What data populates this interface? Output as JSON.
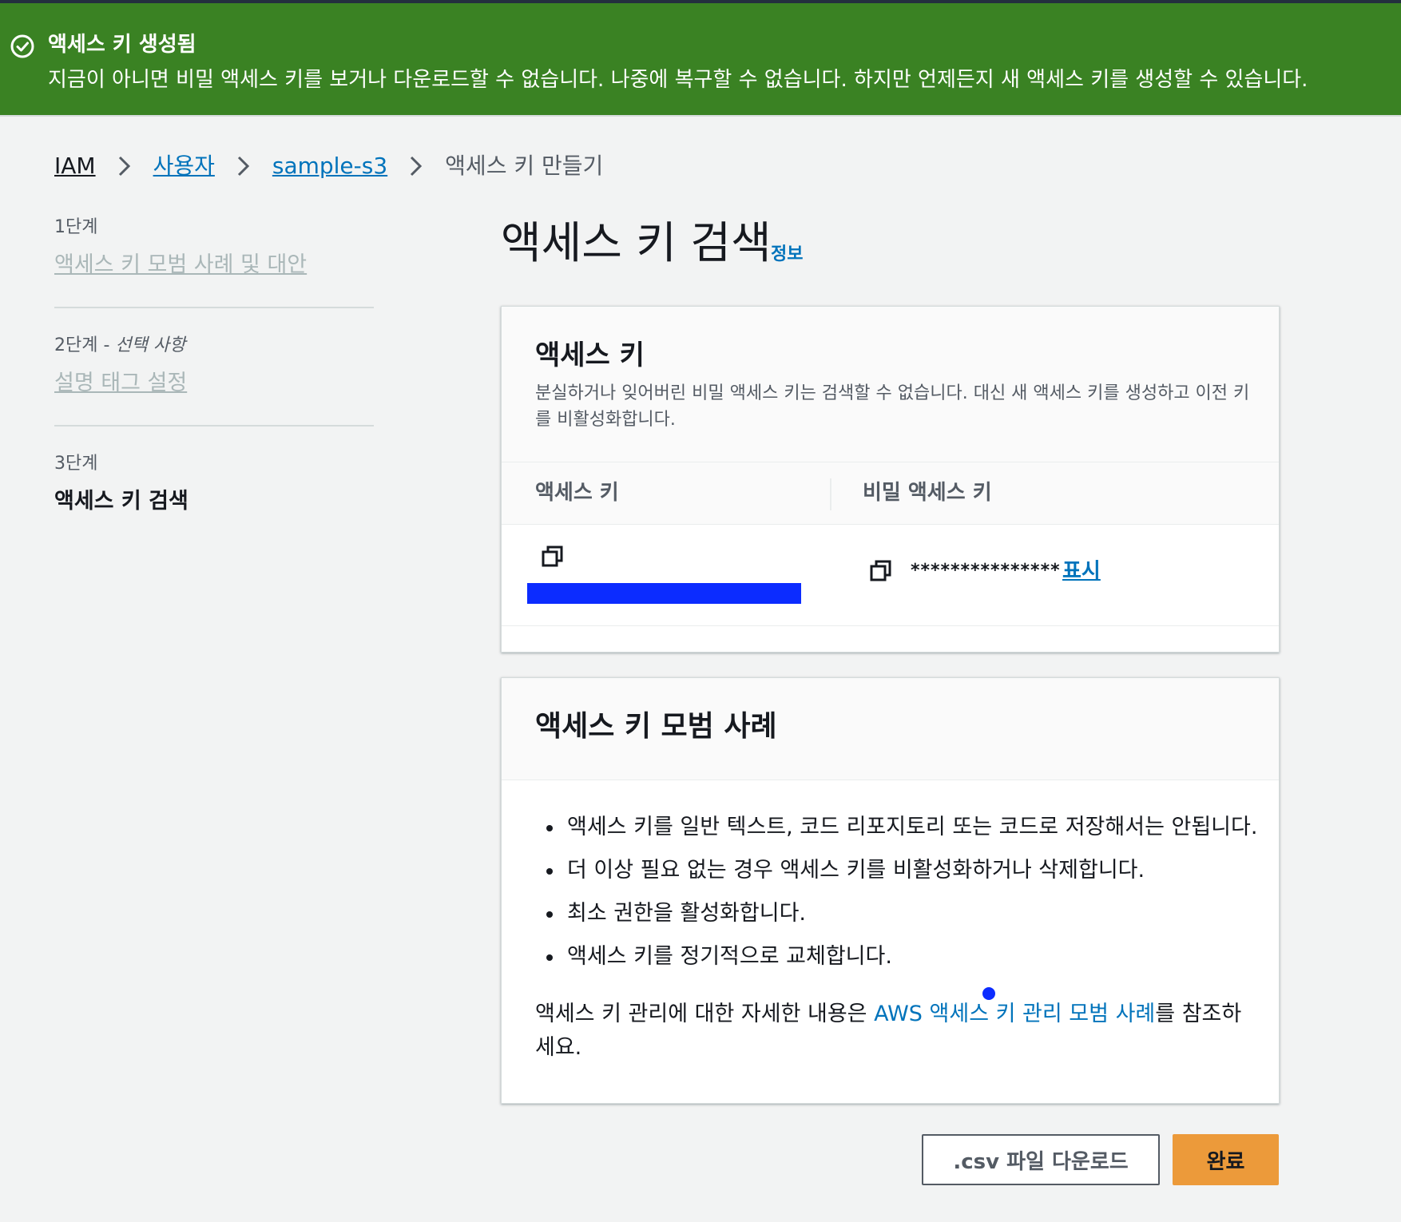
{
  "flash": {
    "title": "액세스 키 생성됨",
    "message": "지금이 아니면 비밀 액세스 키를 보거나 다운로드할 수 없습니다. 나중에 복구할 수 없습니다. 하지만 언제든지 새 액세스 키를 생성할 수 있습니다.",
    "icon": "check-circle-icon",
    "color": "#3a8223"
  },
  "breadcrumb": {
    "items": [
      "IAM",
      "사용자",
      "sample-s3"
    ],
    "current": "액세스 키 만들기"
  },
  "steps": [
    {
      "label": "1단계",
      "optional": "",
      "title": "액세스 키 모범 사례 및 대안"
    },
    {
      "label": "2단계 - ",
      "optional": "선택 사항",
      "title": "설명 태그 설정"
    },
    {
      "label": "3단계",
      "optional": "",
      "title": "액세스 키 검색"
    }
  ],
  "page": {
    "title": "액세스 키 검색",
    "info": "정보"
  },
  "access_key_card": {
    "title": "액세스 키",
    "description": "분실하거나 잊어버린 비밀 액세스 키는 검색할 수 없습니다. 대신 새 액세스 키를 생성하고 이전 키를 비활성화합니다.",
    "columns": [
      "액세스 키",
      "비밀 액세스 키"
    ],
    "secret_masked": "***************",
    "show_label": "표시"
  },
  "best_practices": {
    "title": "액세스 키 모범 사례",
    "items": [
      "액세스 키를 일반 텍스트, 코드 리포지토리 또는 코드로 저장해서는 안됩니다.",
      "더 이상 필요 없는 경우 액세스 키를 비활성화하거나 삭제합니다.",
      "최소 권한을 활성화합니다.",
      "액세스 키를 정기적으로 교체합니다."
    ],
    "footer_prefix": "액세스 키 관리에 대한 자세한 내용은 ",
    "footer_link": "AWS 액세스 키 관리 모범 사례",
    "footer_suffix": "를 참조하세요."
  },
  "buttons": {
    "download_csv": ".csv 파일 다운로드",
    "done": "완료"
  },
  "colors": {
    "accent": "#0073bb",
    "primary_button": "#ec9a3a",
    "success": "#3a8223"
  }
}
